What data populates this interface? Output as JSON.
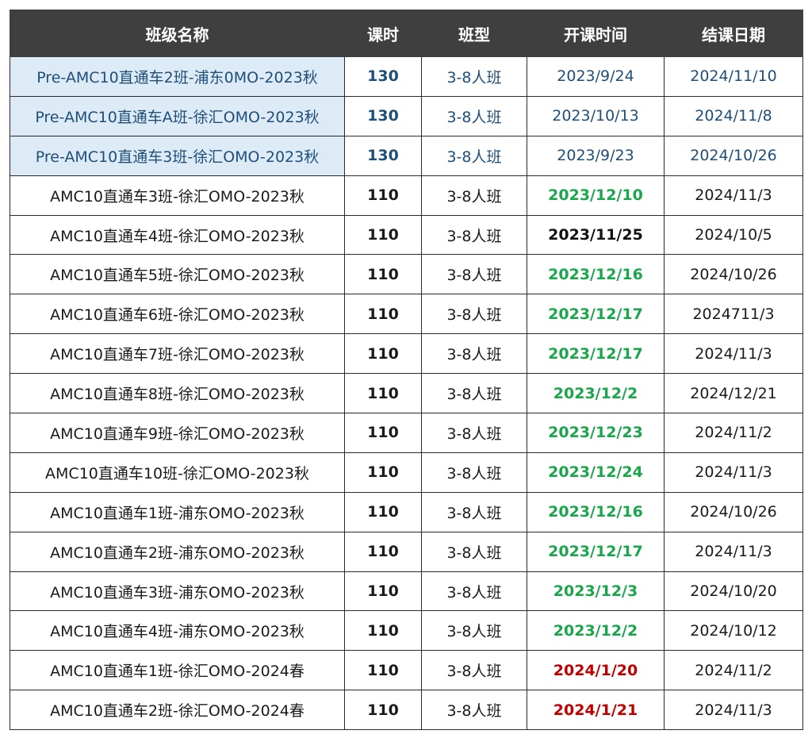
{
  "table": {
    "headers": [
      "班级名称",
      "课时",
      "班型",
      "开课时间",
      "结课日期"
    ],
    "rows": [
      {
        "name": "Pre-AMC10直通车2班-浦东0MO-2023秋",
        "hours": "130",
        "type": "3-8人班",
        "start": "2023/9/24",
        "end": "2024/11/10",
        "style": "pre",
        "start_color": "blue"
      },
      {
        "name": "Pre-AMC10直通车A班-徐汇OMO-2023秋",
        "hours": "130",
        "type": "3-8人班",
        "start": "2023/10/13",
        "end": "2024/11/8",
        "style": "pre",
        "start_color": "blue"
      },
      {
        "name": "Pre-AMC10直通车3班-徐汇OMO-2023秋",
        "hours": "130",
        "type": "3-8人班",
        "start": "2023/9/23",
        "end": "2024/10/26",
        "style": "pre",
        "start_color": "blue"
      },
      {
        "name": "AMC10直通车3班-徐汇OMO-2023秋",
        "hours": "110",
        "type": "3-8人班",
        "start": "2023/12/10",
        "end": "2024/11/3",
        "style": "normal",
        "start_color": "green"
      },
      {
        "name": "AMC10直通车4班-徐汇OMO-2023秋",
        "hours": "110",
        "type": "3-8人班",
        "start": "2023/11/25",
        "end": "2024/10/5",
        "style": "normal",
        "start_color": "black"
      },
      {
        "name": "AMC10直通车5班-徐汇OMO-2023秋",
        "hours": "110",
        "type": "3-8人班",
        "start": "2023/12/16",
        "end": "2024/10/26",
        "style": "normal",
        "start_color": "green"
      },
      {
        "name": "AMC10直通车6班-徐汇OMO-2023秋",
        "hours": "110",
        "type": "3-8人班",
        "start": "2023/12/17",
        "end": "2024711/3",
        "style": "normal",
        "start_color": "green"
      },
      {
        "name": "AMC10直通车7班-徐汇OMO-2023秋",
        "hours": "110",
        "type": "3-8人班",
        "start": "2023/12/17",
        "end": "2024/11/3",
        "style": "normal",
        "start_color": "green"
      },
      {
        "name": "AMC10直通车8班-徐汇OMO-2023秋",
        "hours": "110",
        "type": "3-8人班",
        "start": "2023/12/2",
        "end": "2024/12/21",
        "style": "normal",
        "start_color": "green"
      },
      {
        "name": "AMC10直通车9班-徐汇OMO-2023秋",
        "hours": "110",
        "type": "3-8人班",
        "start": "2023/12/23",
        "end": "2024/11/2",
        "style": "normal",
        "start_color": "green"
      },
      {
        "name": "AMC10直通车10班-徐汇OMO-2023秋",
        "hours": "110",
        "type": "3-8人班",
        "start": "2023/12/24",
        "end": "2024/11/3",
        "style": "normal",
        "start_color": "green"
      },
      {
        "name": "AMC10直通车1班-浦东OMO-2023秋",
        "hours": "110",
        "type": "3-8人班",
        "start": "2023/12/16",
        "end": "2024/10/26",
        "style": "normal",
        "start_color": "green"
      },
      {
        "name": "AMC10直通车2班-浦东OMO-2023秋",
        "hours": "110",
        "type": "3-8人班",
        "start": "2023/12/17",
        "end": "2024/11/3",
        "style": "normal",
        "start_color": "green"
      },
      {
        "name": "AMC10直通车3班-浦东OMO-2023秋",
        "hours": "110",
        "type": "3-8人班",
        "start": "2023/12/3",
        "end": "2024/10/20",
        "style": "normal",
        "start_color": "green"
      },
      {
        "name": "AMC10直通车4班-浦东OMO-2023秋",
        "hours": "110",
        "type": "3-8人班",
        "start": "2023/12/2",
        "end": "2024/10/12",
        "style": "normal",
        "start_color": "green"
      },
      {
        "name": "AMC10直通车1班-徐汇OMO-2024春",
        "hours": "110",
        "type": "3-8人班",
        "start": "2024/1/20",
        "end": "2024/11/2",
        "style": "normal",
        "start_color": "red"
      },
      {
        "name": "AMC10直通车2班-徐汇OMO-2024春",
        "hours": "110",
        "type": "3-8人班",
        "start": "2024/1/21",
        "end": "2024/11/3",
        "style": "normal",
        "start_color": "red"
      }
    ]
  }
}
